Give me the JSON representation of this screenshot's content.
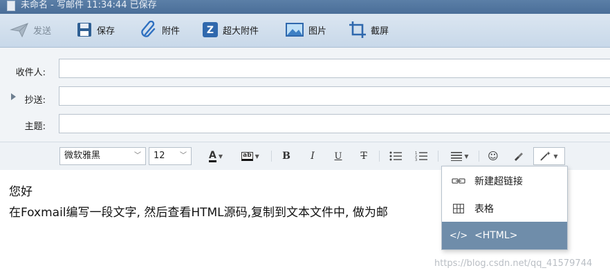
{
  "window": {
    "title": "未命名 - 写邮件   11:34:44 已保存"
  },
  "toolbar": {
    "send": "发送",
    "save": "保存",
    "attach": "附件",
    "big_attach": "超大附件",
    "image": "图片",
    "screenshot": "截屏"
  },
  "fields": {
    "to_label": "收件人:",
    "cc_label": "抄送:",
    "subject_label": "主题:",
    "to_value": "",
    "cc_value": "",
    "subject_value": ""
  },
  "format": {
    "font": "微软雅黑",
    "size": "12",
    "font_color_glyph": "A",
    "highlight_glyph": "ab",
    "bold": "B",
    "italic": "I",
    "underline": "U",
    "strike": "T"
  },
  "body": {
    "line1": "您好",
    "line2": "在Foxmail编写一段文字, 然后查看HTML源码,复制到文本文件中, 做为邮"
  },
  "insert_menu": {
    "items": [
      {
        "label": "新建超链接",
        "icon": "link-icon"
      },
      {
        "label": "表格",
        "icon": "table-icon"
      },
      {
        "label": "<HTML>",
        "icon": "code-icon"
      }
    ]
  },
  "watermark": "https://blog.csdn.net/qq_41579744"
}
